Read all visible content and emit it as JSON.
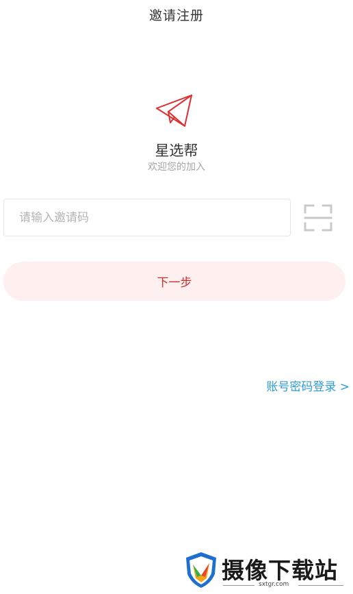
{
  "header": {
    "title": "邀请注册"
  },
  "app": {
    "name": "星选帮",
    "welcome": "欢迎您的加入",
    "logo_icon": "paper-plane-icon"
  },
  "form": {
    "invite_code_value": "",
    "invite_code_placeholder": "请输入邀请码",
    "scan_icon": "scan-icon",
    "next_label": "下一步"
  },
  "links": {
    "password_login": "账号密码登录 >"
  },
  "watermark": {
    "text": "摄像下载站",
    "sub": "sxtgr.com"
  },
  "colors": {
    "accent_red": "#d92b2b",
    "button_bg": "#fdf0ee",
    "link_blue": "#2d9bd8",
    "placeholder": "#b5b5b5"
  }
}
